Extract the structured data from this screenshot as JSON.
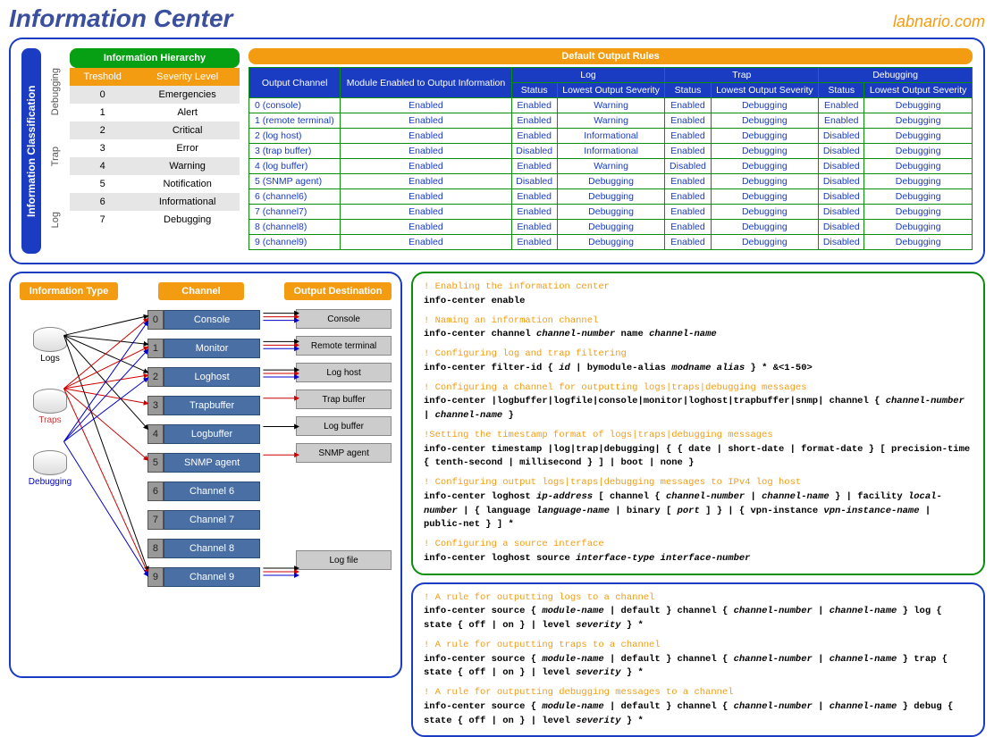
{
  "header": {
    "title": "Information Center",
    "brand": "labnario.com"
  },
  "classTab": "Information Classification",
  "ranges": [
    {
      "label": "Debugging"
    },
    {
      "label": "Trap"
    },
    {
      "label": "Log"
    }
  ],
  "hier": {
    "title": "Information Hierarchy",
    "cols": [
      "Treshold",
      "Severity Level"
    ],
    "rows": [
      {
        "t": "0",
        "s": "Emergencies"
      },
      {
        "t": "1",
        "s": "Alert"
      },
      {
        "t": "2",
        "s": "Critical"
      },
      {
        "t": "3",
        "s": "Error"
      },
      {
        "t": "4",
        "s": "Warning"
      },
      {
        "t": "5",
        "s": "Notification"
      },
      {
        "t": "6",
        "s": "Informational"
      },
      {
        "t": "7",
        "s": "Debugging"
      }
    ]
  },
  "rules": {
    "title": "Default Output Rules",
    "head": {
      "ch": "Output Channel",
      "mod": "Module Enabled to Output Information",
      "groups": [
        "Log",
        "Trap",
        "Debugging"
      ],
      "sub": [
        "Status",
        "Lowest Output Severity"
      ]
    },
    "rows": [
      {
        "ch": "0 (console)",
        "mod": "Enabled",
        "log": [
          "Enabled",
          "Warning"
        ],
        "trap": [
          "Enabled",
          "Debugging"
        ],
        "dbg": [
          "Enabled",
          "Debugging"
        ]
      },
      {
        "ch": "1 (remote terminal)",
        "mod": "Enabled",
        "log": [
          "Enabled",
          "Warning"
        ],
        "trap": [
          "Enabled",
          "Debugging"
        ],
        "dbg": [
          "Enabled",
          "Debugging"
        ]
      },
      {
        "ch": "2 (log host)",
        "mod": "Enabled",
        "log": [
          "Enabled",
          "Informational"
        ],
        "trap": [
          "Enabled",
          "Debugging"
        ],
        "dbg": [
          "Disabled",
          "Debugging"
        ]
      },
      {
        "ch": "3 (trap buffer)",
        "mod": "Enabled",
        "log": [
          "Disabled",
          "Informational"
        ],
        "trap": [
          "Enabled",
          "Debugging"
        ],
        "dbg": [
          "Disabled",
          "Debugging"
        ]
      },
      {
        "ch": "4 (log buffer)",
        "mod": "Enabled",
        "log": [
          "Enabled",
          "Warning"
        ],
        "trap": [
          "Disabled",
          "Debugging"
        ],
        "dbg": [
          "Disabled",
          "Debugging"
        ]
      },
      {
        "ch": "5 (SNMP agent)",
        "mod": "Enabled",
        "log": [
          "Disabled",
          "Debugging"
        ],
        "trap": [
          "Enabled",
          "Debugging"
        ],
        "dbg": [
          "Disabled",
          "Debugging"
        ]
      },
      {
        "ch": "6 (channel6)",
        "mod": "Enabled",
        "log": [
          "Enabled",
          "Debugging"
        ],
        "trap": [
          "Enabled",
          "Debugging"
        ],
        "dbg": [
          "Disabled",
          "Debugging"
        ]
      },
      {
        "ch": "7 (channel7)",
        "mod": "Enabled",
        "log": [
          "Enabled",
          "Debugging"
        ],
        "trap": [
          "Enabled",
          "Debugging"
        ],
        "dbg": [
          "Disabled",
          "Debugging"
        ]
      },
      {
        "ch": "8 (channel8)",
        "mod": "Enabled",
        "log": [
          "Enabled",
          "Debugging"
        ],
        "trap": [
          "Enabled",
          "Debugging"
        ],
        "dbg": [
          "Disabled",
          "Debugging"
        ]
      },
      {
        "ch": "9 (channel9)",
        "mod": "Enabled",
        "log": [
          "Enabled",
          "Debugging"
        ],
        "trap": [
          "Enabled",
          "Debugging"
        ],
        "dbg": [
          "Disabled",
          "Debugging"
        ]
      }
    ]
  },
  "diagram": {
    "colHeads": [
      "Information Type",
      "Channel",
      "Output Destination"
    ],
    "types": [
      {
        "label": "Logs",
        "color": "#000"
      },
      {
        "label": "Traps",
        "color": "#c33"
      },
      {
        "label": "Debugging",
        "color": "#00c"
      }
    ],
    "channels": [
      {
        "n": "0",
        "name": "Console",
        "dest": "Console"
      },
      {
        "n": "1",
        "name": "Monitor",
        "dest": "Remote terminal"
      },
      {
        "n": "2",
        "name": "Loghost",
        "dest": "Log host"
      },
      {
        "n": "3",
        "name": "Trapbuffer",
        "dest": "Trap buffer"
      },
      {
        "n": "4",
        "name": "Logbuffer",
        "dest": "Log buffer"
      },
      {
        "n": "5",
        "name": "SNMP agent",
        "dest": "SNMP agent"
      },
      {
        "n": "6",
        "name": "Channel 6",
        "dest": ""
      },
      {
        "n": "7",
        "name": "Channel 7",
        "dest": ""
      },
      {
        "n": "8",
        "name": "Channel 8",
        "dest": ""
      },
      {
        "n": "9",
        "name": "Channel 9",
        "dest": "Log file"
      }
    ]
  },
  "cmds": {
    "box1": [
      {
        "c": "! Enabling the information center",
        "t": "info-center enable"
      },
      {
        "c": "! Naming an information channel",
        "t": "info-center channel <i>channel-number</i> name <i>channel-name</i>"
      },
      {
        "c": "! Configuring log and trap filtering",
        "t": "info-center filter-id { <i>id</i> | bymodule-alias <i>modname alias</i> } * &<1-50>"
      },
      {
        "c": "! Configuring a channel for outputting logs|traps|debugging messages",
        "t": "info-center |logbuffer|logfile|console|monitor|loghost|trapbuffer|snmp| channel { <i>channel-number</i> | <i>channel-name</i> }"
      },
      {
        "c": "!Setting the timestamp format of logs|traps|debugging messages",
        "t": "info-center timestamp |log|trap|debugging| { { date | short-date | format-date } [ precision-time { tenth-second | millisecond } ] | boot | none }"
      },
      {
        "c": "! Configuring output logs|traps|debugging messages to IPv4 log host",
        "t": "info-center loghost <i>ip-address</i> [ channel { <i>channel-number</i> | <i>channel-name</i> } | facility <i>local-number</i> | { language <i>language-name</i> | binary [ <i>port</i> ] } | { vpn-instance <i>vpn-instance-name</i> | public-net } ] *"
      },
      {
        "c": "! Configuring a source interface",
        "t": "info-center loghost source <i>interface-type interface-number</i>"
      }
    ],
    "box2": [
      {
        "c": "! A rule for outputting logs to a channel",
        "t": "info-center source { <i>module-name</i> | default } channel { <i>channel-number</i> | <i>channel-name</i> } log { state { off | on } | level <i>severity</i> } *"
      },
      {
        "c": "! A rule for outputting traps to a channel",
        "t": "info-center source { <i>module-name</i> | default } channel { <i>channel-number</i> | <i>channel-name</i> } trap { state { off | on } | level <i>severity</i> } *"
      },
      {
        "c": "! A rule for outputting debugging messages to a channel",
        "t": "info-center source { <i>module-name</i> | default } channel { <i>channel-number</i> | <i>channel-name</i> } debug { state { off | on } | level <i>severity</i> } *"
      }
    ]
  }
}
